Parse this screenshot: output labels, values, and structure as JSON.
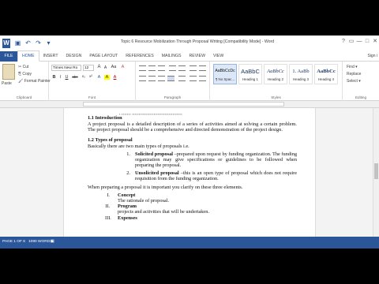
{
  "window": {
    "app_icon": "W",
    "title": "Topic 6 Resource Mobilization Through Proposal Writing [Compatibility Mode] - Word",
    "quick_access": [
      {
        "icon": "save-icon",
        "glyph": "▣"
      },
      {
        "icon": "undo-icon",
        "glyph": "↶"
      },
      {
        "icon": "redo-icon",
        "glyph": "↷"
      },
      {
        "icon": "customize-icon",
        "glyph": "▾"
      }
    ],
    "controls": [
      "?",
      "▭",
      "—",
      "□",
      "✕"
    ]
  },
  "tabs": [
    "FILE",
    "HOME",
    "INSERT",
    "DESIGN",
    "PAGE LAYOUT",
    "REFERENCES",
    "MAILINGS",
    "REVIEW",
    "VIEW"
  ],
  "active_tab": "HOME",
  "sign_in": "Sign i",
  "ribbon": {
    "clipboard": {
      "label": "Clipboard",
      "paste": "Paste",
      "cut": "✂ Cut",
      "copy": "⎘ Copy",
      "format_painter": "🖌 Format Painter"
    },
    "font": {
      "label": "Font",
      "family": "Times New Ro",
      "size": "12",
      "grow": "A",
      "shrink": "A",
      "case": "Aa",
      "clear": "A",
      "buttons": [
        "B",
        "I",
        "U",
        "abc",
        "x₂",
        "x²",
        "A",
        "A",
        "A"
      ]
    },
    "paragraph": {
      "label": "Paragraph"
    },
    "styles": {
      "label": "Styles",
      "items": [
        {
          "sample": "AaBbCcDc",
          "name": "¶ No Spac...",
          "selected": true
        },
        {
          "sample": "AaBbC",
          "name": "Heading 1",
          "selected": false
        },
        {
          "sample": "AaBbCc",
          "name": "Heading 2",
          "selected": false
        },
        {
          "sample": "1. AaBb",
          "name": "Heading 3",
          "selected": false
        },
        {
          "sample": "AaBbCc",
          "name": "Heading 4",
          "selected": false
        }
      ]
    },
    "editing": {
      "label": "Editing",
      "find": "Find ▾",
      "replace": "Replace",
      "select": "Select ▾"
    }
  },
  "document": {
    "partial_top": "▪    ▪▪▪▪▪▪▪  ▪▪▪▪▪▪▪▪▪▪▪▪▪▪▪▪▪▪▪▪▪▪▪▪▪▪▪▪▪▪▪▪▪▪▪▪▪",
    "h1": "1.1 Introduction",
    "p1": "A project proposal is a detailed description of a series of activities aimed at solving a certain problem. The project proposal should be a comprehensive and directed demonstration of the project design.",
    "h2": "1.2 Types of proposal",
    "p2": "Basically there are two main types of proposals i.e.",
    "item1_num": "1.",
    "item1_title": "Solicited proposal",
    "item1_text": " –prepared upon request by funding organization. The funding organization may give specifications or guidelines to be followed when preparing the proposal.",
    "item2_num": "2.",
    "item2_title": "Unsolicited proposal",
    "item2_text": " –this is an open type of proposal which does not require requisition from the funding organization.",
    "p3": "When preparing a proposal it is important you clarify on these three elements.",
    "r1_num": "I.",
    "r1_title": "Concept",
    "r1_text": "The rationale of proposal.",
    "r2_num": "II.",
    "r2_title": "Program",
    "r2_text": "projects and activities that will be undertaken.",
    "r3_num": "III.",
    "r3_title": "Expenses"
  },
  "status": {
    "page": "PAGE 1 OF 6",
    "words": "1090 WORDS",
    "proof_icon": "▣"
  }
}
